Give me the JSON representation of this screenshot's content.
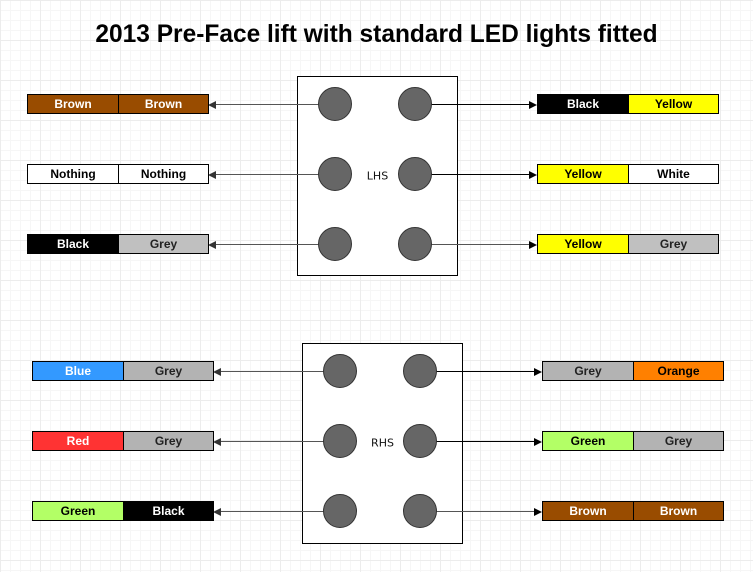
{
  "title": "2013 Pre-Face lift with standard LED lights fitted",
  "colors": {
    "Brown": {
      "bg": "#994C00",
      "fg": "#ffffff"
    },
    "Nothing": {
      "bg": "#ffffff",
      "fg": "#000000"
    },
    "Black": {
      "bg": "#000000",
      "fg": "#ffffff"
    },
    "Grey": {
      "bg": "#C0C0C0",
      "fg": "#222222"
    },
    "Grey2": {
      "bg": "#B3B3B3",
      "fg": "#222222"
    },
    "Yellow": {
      "bg": "#FFFF00",
      "fg": "#000000"
    },
    "White": {
      "bg": "#ffffff",
      "fg": "#000000"
    },
    "Blue": {
      "bg": "#3399FF",
      "fg": "#ffffff"
    },
    "Red": {
      "bg": "#FF3333",
      "fg": "#ffffff"
    },
    "Green": {
      "bg": "#B3FF66",
      "fg": "#000000"
    },
    "Orange": {
      "bg": "#FF8000",
      "fg": "#000000"
    }
  },
  "connectors": [
    {
      "label": "LHS",
      "left_wires": [
        {
          "colors": [
            "Brown",
            "Brown"
          ]
        },
        {
          "colors": [
            "Nothing",
            "Nothing"
          ]
        },
        {
          "colors": [
            "Black",
            "Grey"
          ]
        }
      ],
      "right_wires": [
        {
          "colors": [
            "Black",
            "Yellow"
          ]
        },
        {
          "colors": [
            "Yellow",
            "White"
          ]
        },
        {
          "colors": [
            "Yellow",
            "Grey"
          ]
        }
      ]
    },
    {
      "label": "RHS",
      "left_wires": [
        {
          "colors": [
            "Blue",
            "Grey"
          ]
        },
        {
          "colors": [
            "Red",
            "Grey"
          ]
        },
        {
          "colors": [
            "Green",
            "Black"
          ]
        }
      ],
      "right_wires": [
        {
          "colors": [
            "Grey",
            "Orange"
          ]
        },
        {
          "colors": [
            "Green",
            "Grey"
          ]
        },
        {
          "colors": [
            "Brown",
            "Brown"
          ]
        }
      ]
    }
  ]
}
